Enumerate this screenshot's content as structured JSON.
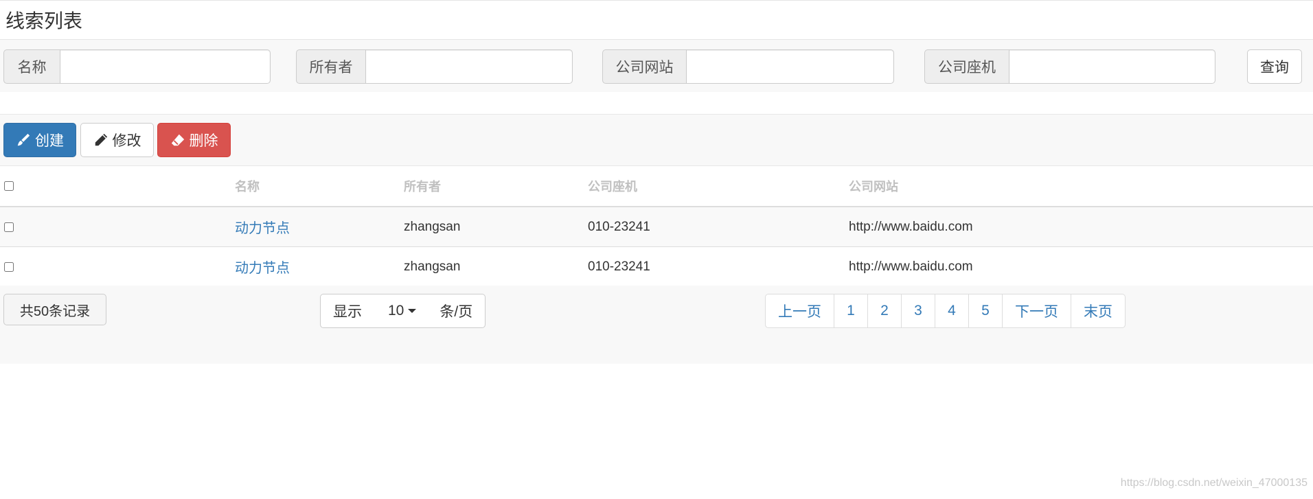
{
  "page": {
    "title": "线索列表"
  },
  "search": {
    "name_label": "名称",
    "name_value": "",
    "owner_label": "所有者",
    "owner_value": "",
    "website_label": "公司网站",
    "website_value": "",
    "phone_label": "公司座机",
    "phone_value": "",
    "query_label": "查询"
  },
  "toolbar": {
    "create_label": "创建",
    "edit_label": "修改",
    "delete_label": "删除"
  },
  "table": {
    "headers": [
      "名称",
      "所有者",
      "公司座机",
      "公司网站"
    ],
    "rows": [
      {
        "name": "动力节点",
        "owner": "zhangsan",
        "phone": "010-23241",
        "website": "http://www.baidu.com"
      },
      {
        "name": "动力节点",
        "owner": "zhangsan",
        "phone": "010-23241",
        "website": "http://www.baidu.com"
      }
    ]
  },
  "footer": {
    "total_label": "共50条记录",
    "page_size_prefix": "显示",
    "page_size_value": "10",
    "page_size_suffix": "条/页",
    "pagination": {
      "prev_label": "上一页",
      "pages": [
        "1",
        "2",
        "3",
        "4",
        "5"
      ],
      "next_label": "下一页",
      "last_label": "末页"
    }
  },
  "watermark": "https://blog.csdn.net/weixin_47000135",
  "colors": {
    "primary": "#337ab7",
    "danger": "#d9534f"
  },
  "icons": {
    "create": "pencil-brush-icon",
    "edit": "pencil-icon",
    "delete": "eraser-icon"
  }
}
